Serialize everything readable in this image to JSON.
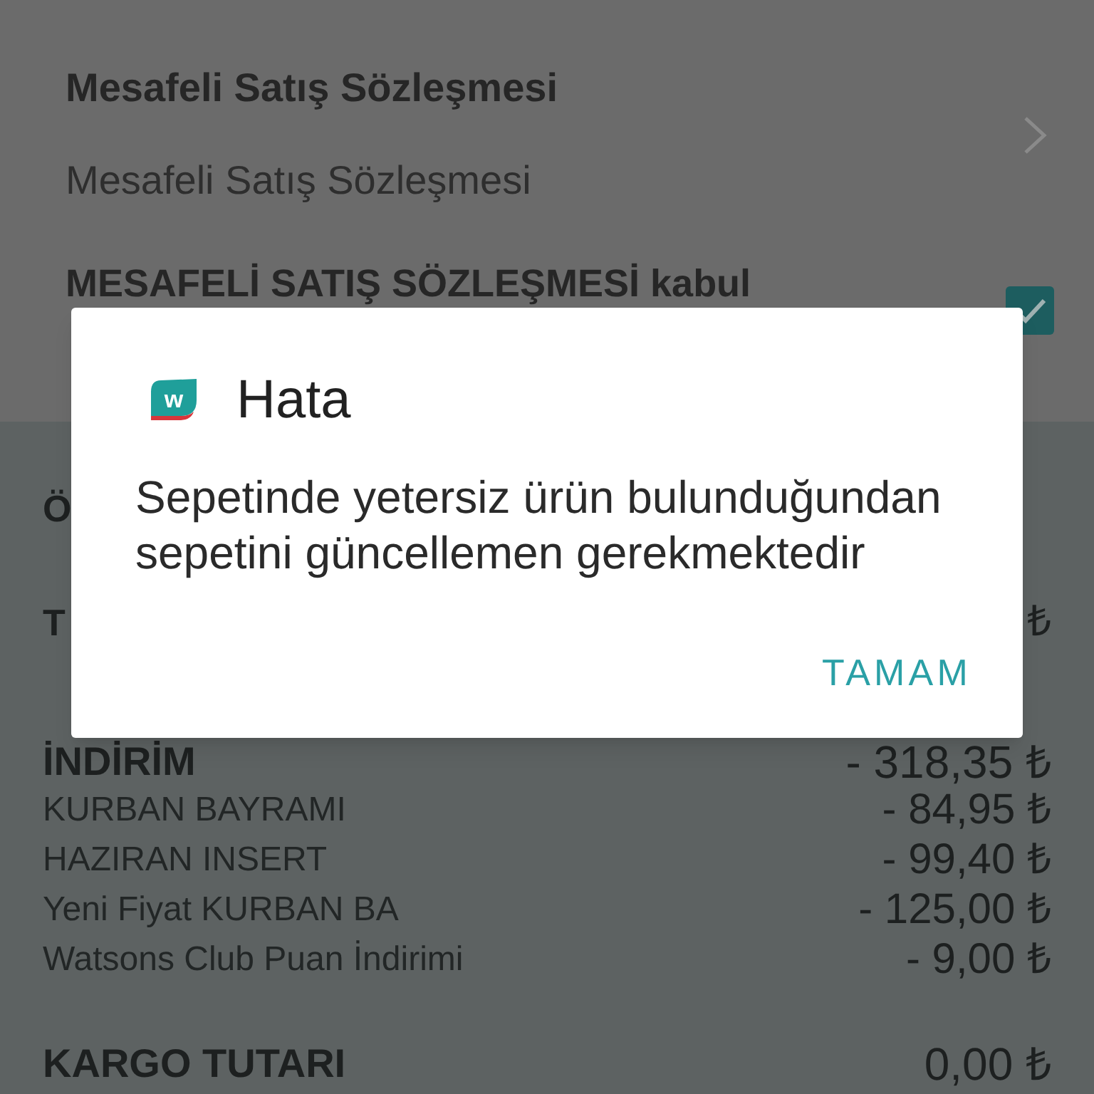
{
  "contract": {
    "title": "Mesafeli Satış Sözleşmesi",
    "subtitle": "Mesafeli Satış Sözleşmesi",
    "acceptance": {
      "label": "MESAFELİ SATIŞ SÖZLEŞMESİ kabul",
      "checked": true
    }
  },
  "summary": {
    "partial_rows": [
      {
        "label": "Ö"
      },
      {
        "label": "T",
        "amount": "₺"
      }
    ],
    "discount": {
      "label": "İNDİRİM",
      "amount": "- 318,35 ₺",
      "items": [
        {
          "label": "KURBAN BAYRAMI",
          "amount": "- 84,95 ₺"
        },
        {
          "label": "HAZIRAN INSERT",
          "amount": "- 99,40 ₺"
        },
        {
          "label": "Yeni Fiyat KURBAN BA",
          "amount": "- 125,00 ₺"
        },
        {
          "label": "Watsons Club Puan İndirimi",
          "amount": "- 9,00 ₺"
        }
      ]
    },
    "shipping": {
      "label": "KARGO TUTARI",
      "amount": "0,00 ₺"
    }
  },
  "dialog": {
    "logo_text": "w",
    "title": "Hata",
    "message": "Sepetinde yetersiz ürün bulunduğundan sepetini güncellemen gerekmektedir",
    "buttons": [
      "TAMAM"
    ]
  }
}
